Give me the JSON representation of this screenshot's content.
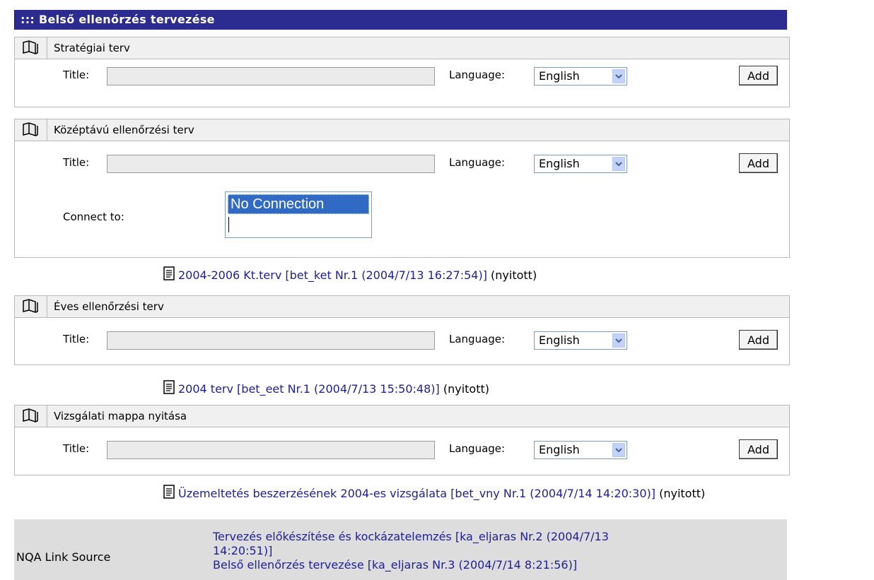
{
  "header": {
    "title": "::: Belső ellenőrzés tervezése"
  },
  "labels": {
    "title": "Title:",
    "language": "Language:",
    "add": "Add",
    "connect_to": "Connect to:"
  },
  "sections": [
    {
      "name": "Stratégiai terv",
      "language": "English"
    },
    {
      "name": "Középtávú ellenőrzési terv",
      "language": "English",
      "connect_options": [
        "No Connection"
      ]
    },
    {
      "name": "Éves ellenőrzési terv",
      "language": "English"
    },
    {
      "name": "Vizsgálati mappa nyitása",
      "language": "English"
    }
  ],
  "docs": [
    {
      "link": "2004-2006 Kt.terv [bet_ket Nr.1 (2004/7/13 16:27:54)]",
      "status": "(nyitott)"
    },
    {
      "link": "2004 terv [bet_eet Nr.1 (2004/7/13 15:50:48)]",
      "status": "(nyitott)"
    },
    {
      "link": "Üzemeltetés beszerzésének 2004-es vizsgálata [bet_vny Nr.1 (2004/7/14 14:20:30)]",
      "status": "(nyitott)"
    }
  ],
  "link_source": {
    "label": "NQA Link Source",
    "links": [
      "Tervezés előkészítése és kockázatelemzés [ka_eljaras Nr.2 (2004/7/13",
      "14:20:51)]",
      "Belső ellenőrzés tervezése [ka_eljaras Nr.3 (2004/7/14 8:21:56)]"
    ]
  },
  "icons": {
    "section": "folder-book-icon",
    "doc": "document-icon",
    "dropdown": "chevron-down-icon"
  }
}
